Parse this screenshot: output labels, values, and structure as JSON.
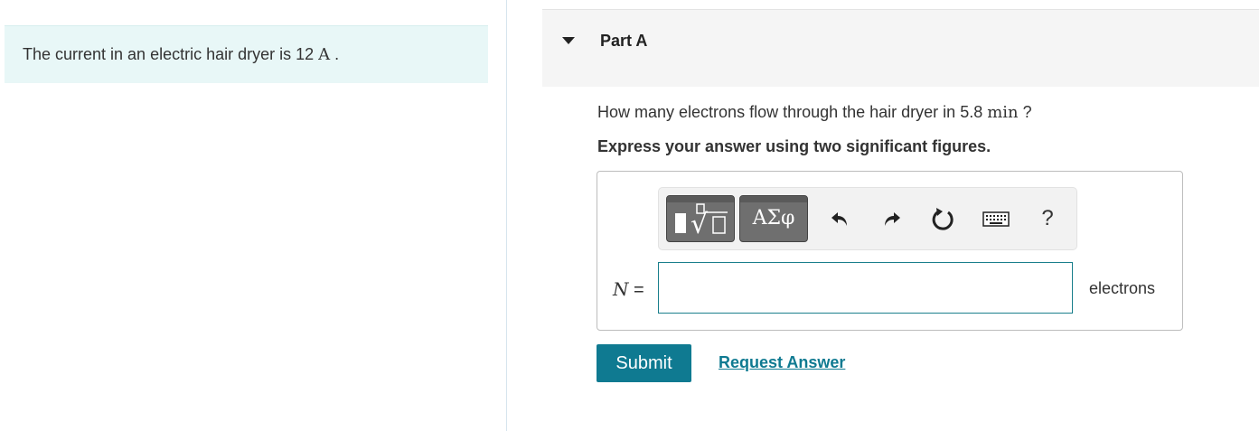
{
  "intro": {
    "text_prefix": "The current in an electric hair dryer is ",
    "value": "12",
    "unit": "A",
    "suffix": " ."
  },
  "part": {
    "title": "Part A",
    "question_prefix": "How many electrons flow through the hair dryer in ",
    "question_value": "5.8",
    "question_unit": "min",
    "question_suffix": " ?",
    "instruction": "Express your answer using two significant figures."
  },
  "toolbar": {
    "symbols_label": "ΑΣφ",
    "help_label": "?",
    "icons": [
      "templates-icon",
      "undo-icon",
      "redo-icon",
      "reset-icon",
      "keyboard-icon",
      "help-icon"
    ]
  },
  "answer": {
    "variable": "N",
    "equals": " =",
    "value": "",
    "units": "electrons"
  },
  "actions": {
    "submit_label": "Submit",
    "request_label": "Request Answer"
  }
}
